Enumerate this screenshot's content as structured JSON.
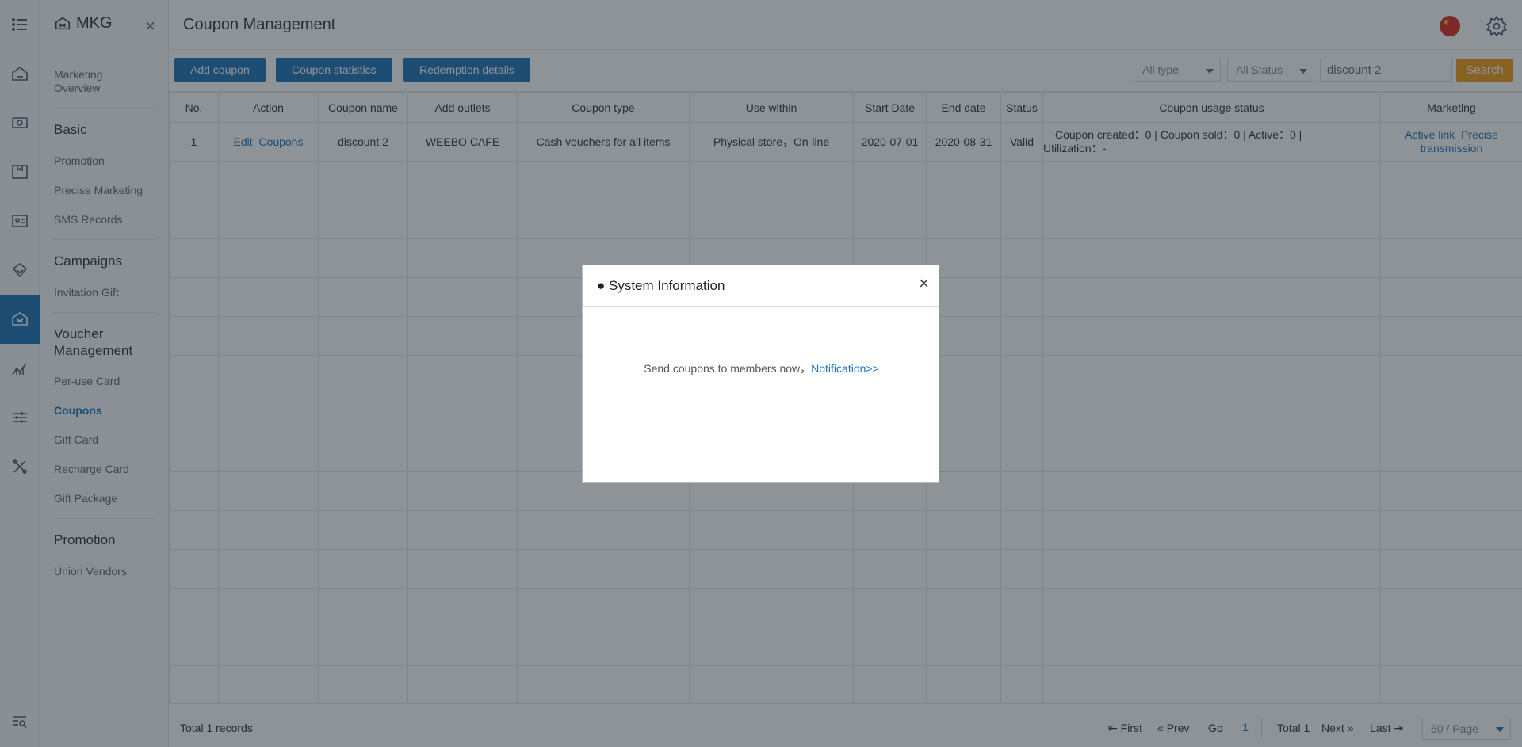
{
  "sidebar": {
    "brand": "MKG",
    "close_label": "×",
    "groups": [
      {
        "label": "Marketing Overview"
      },
      {
        "label": "Basic"
      },
      {
        "label": "Campaigns"
      },
      {
        "label": "Voucher Management"
      },
      {
        "label": "Promotion"
      }
    ],
    "items": {
      "promotion": "Promotion",
      "precise_marketing": "Precise Marketing",
      "sms_records": "SMS Records",
      "invitation_gift": "Invitation Gift",
      "per_use_card": "Per-use Card",
      "coupons": "Coupons",
      "gift_card": "Gift Card",
      "recharge_card": "Recharge Card",
      "gift_package": "Gift Package",
      "union_vendors": "Union Vendors"
    },
    "active_item": "Coupons"
  },
  "rail_icons": [
    "menu-icon",
    "home-icon",
    "cash-icon",
    "box-icon",
    "member-card-icon",
    "diamond-icon",
    "voucher-icon",
    "chart-icon",
    "sliders-icon",
    "tools-icon",
    "search-list-icon"
  ],
  "header": {
    "title": "Coupon Management"
  },
  "toolbar": {
    "add_coupon": "Add coupon",
    "coupon_statistics": "Coupon statistics",
    "redemption_details": "Redemption details",
    "type_filter": "All type",
    "status_filter": "All Status",
    "search_value": "discount 2",
    "search_label": "Search"
  },
  "table": {
    "columns": [
      "No.",
      "Action",
      "Coupon name",
      "Add outlets",
      "Coupon type",
      "Use within",
      "Start Date",
      "End date",
      "Status",
      "Coupon usage status",
      "Marketing"
    ],
    "rows": [
      {
        "no": "1",
        "action_edit": "Edit",
        "action_coupons": "Coupons",
        "name": "discount 2",
        "outlets": "WEEBO CAFE",
        "type": "Cash vouchers for all items",
        "use_within": "Physical store，On-line",
        "start": "2020-07-01",
        "end": "2020-08-31",
        "status": "Valid",
        "usage_line1": "Coupon created：0 | Coupon sold：0 | Active：0 |",
        "usage_line2": "Utilization：-",
        "marketing_active_link": "Active link",
        "marketing_precise": "Precise transmission"
      }
    ]
  },
  "footer": {
    "total_records": "Total 1 records",
    "first": "First",
    "prev": "Prev",
    "go": "Go",
    "page": "1",
    "total": "Total 1",
    "next": "Next",
    "last": "Last",
    "page_size": "50 / Page"
  },
  "modal": {
    "title": "● System Information",
    "close": "×",
    "message": "Send coupons to members now，",
    "link": "Notification>>"
  },
  "colors": {
    "accent": "#1f73b7",
    "search": "#f39c12",
    "overlay": "rgba(30,40,50,0.5)"
  }
}
